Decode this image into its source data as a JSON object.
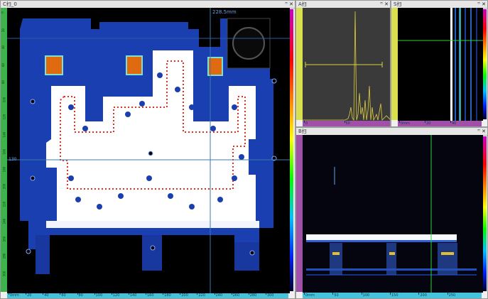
{
  "panels": {
    "c": {
      "title": "C扫_0",
      "measure": "228.5mm",
      "crosshair_label": "130",
      "pin": "ꟸ",
      "close": "✕"
    },
    "a": {
      "title": "A扫",
      "pin": "ꟸ",
      "close": "✕"
    },
    "s": {
      "title": "S扫",
      "pin": "ꟸ",
      "close": "✕"
    },
    "b": {
      "title": "B扫",
      "pin": "ꟸ",
      "close": "✕"
    }
  },
  "rulers": {
    "c_bottom": [
      "0mm",
      "20",
      "40",
      "60",
      "80",
      "100",
      "120",
      "140",
      "160",
      "180",
      "200",
      "220",
      "240",
      "260",
      "280",
      "300"
    ],
    "c_left": [
      "0",
      "20",
      "40",
      "60",
      "80",
      "100",
      "120",
      "140",
      "160",
      "180",
      "200",
      "220",
      "240",
      "260",
      "280",
      "300"
    ],
    "a_bottom": [
      "0",
      "50"
    ],
    "s_bottom": [
      "0mm",
      "20",
      "40"
    ],
    "b_bottom": [
      "0mm",
      "50",
      "100",
      "150",
      "200",
      "250"
    ]
  },
  "colors": {
    "ruler_green": "#3cb44b",
    "ruler_cyan": "#46c3dc",
    "ruler_purple": "#a050a8",
    "ruler_yellow": "#d8e050",
    "scan_blue": "#1a3fb0",
    "cursor_green": "#30d040"
  }
}
